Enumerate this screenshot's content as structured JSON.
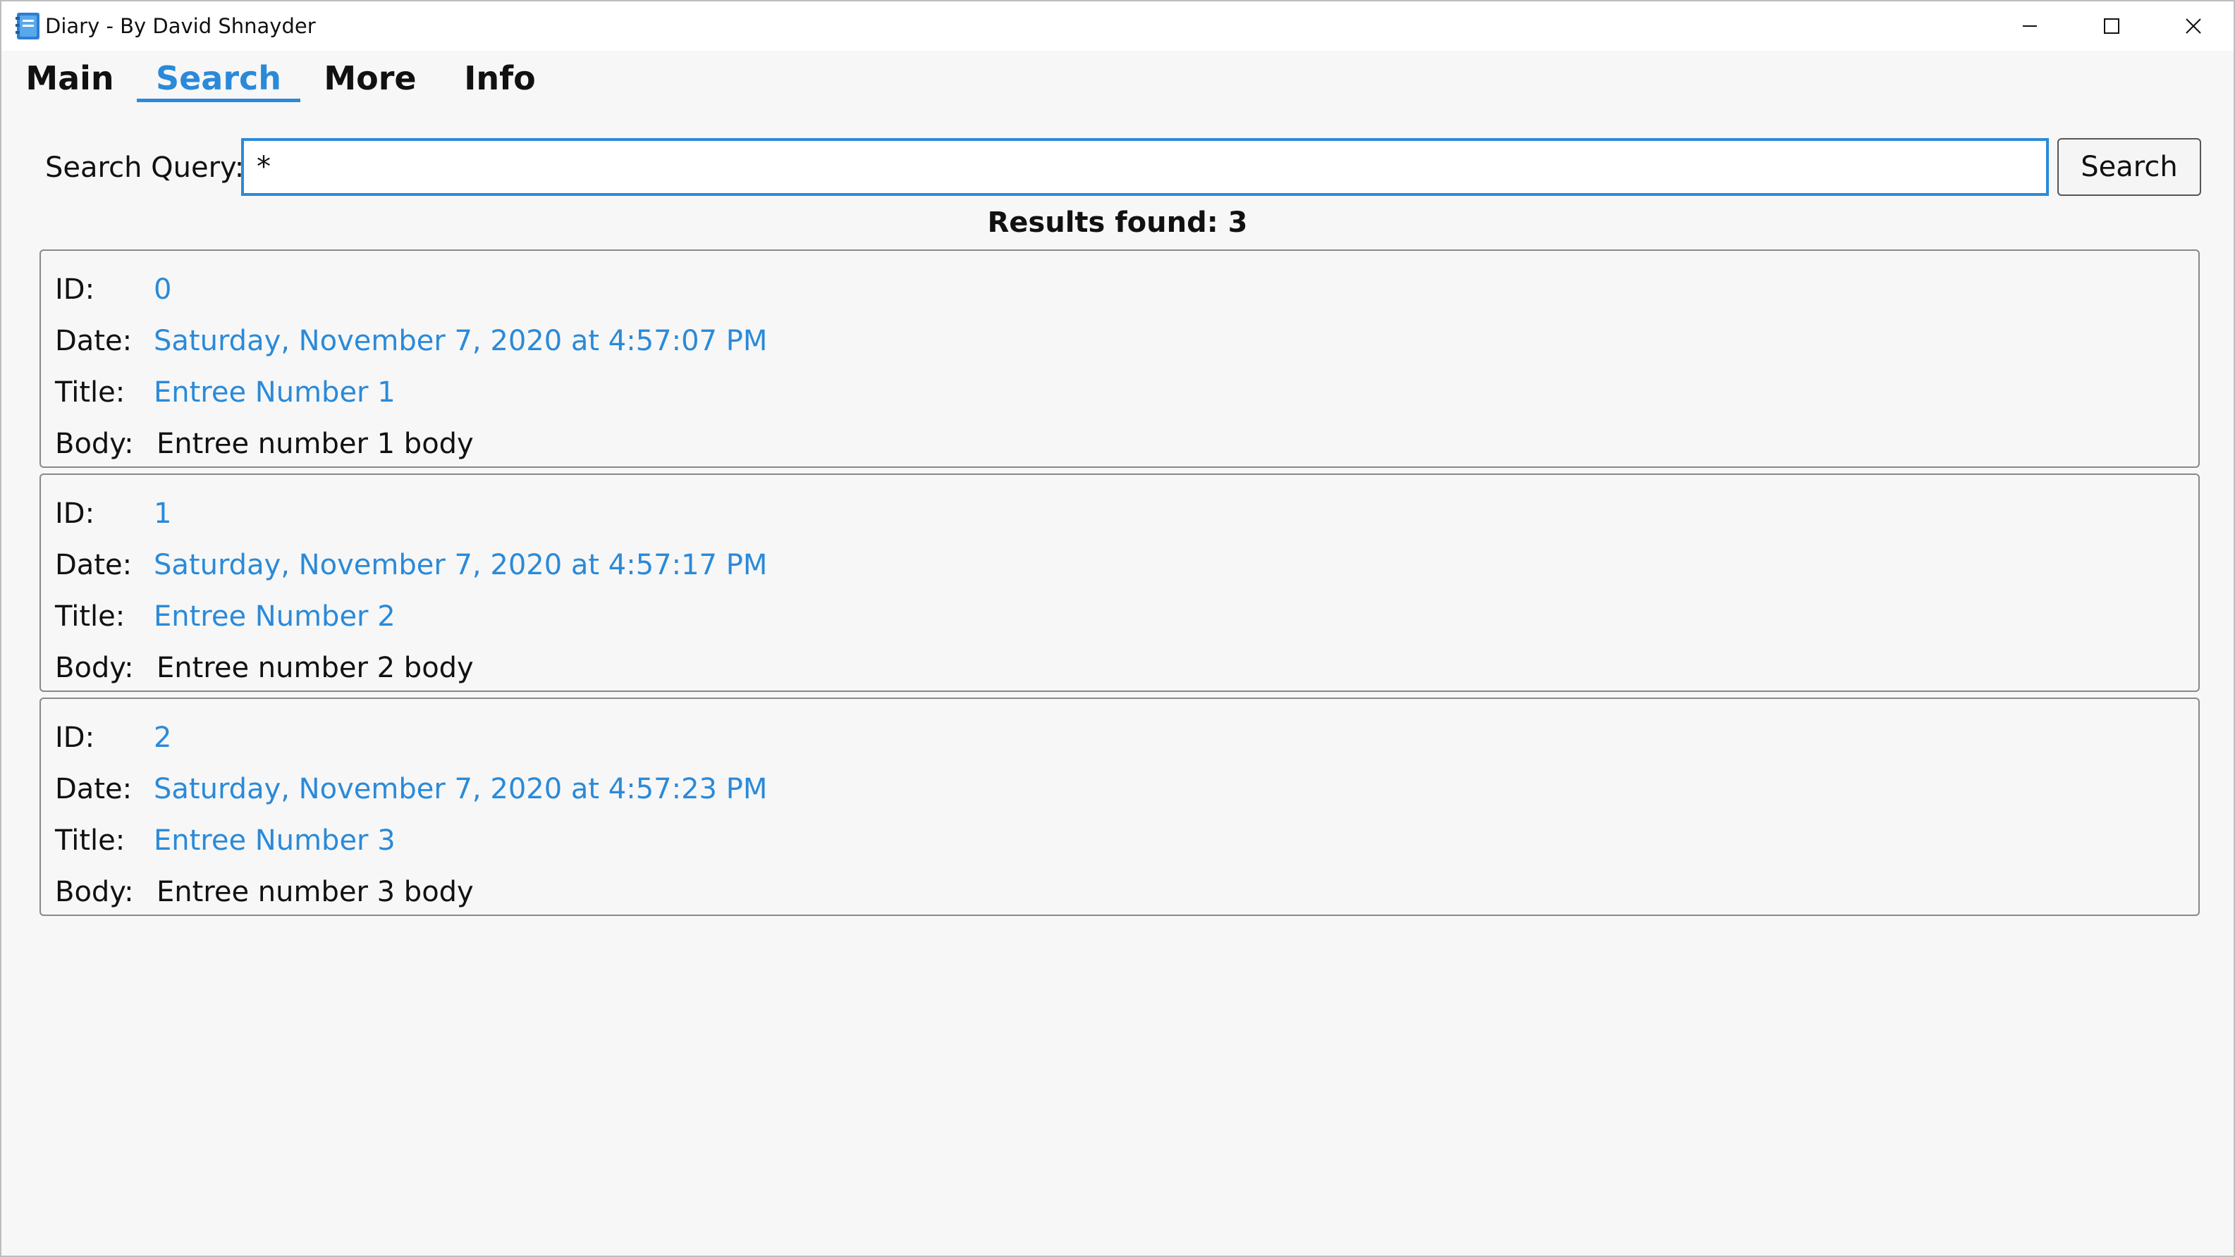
{
  "window": {
    "title": "Diary - By David Shnayder",
    "icon": "diary-book-icon"
  },
  "colors": {
    "accent": "#2a8ad9",
    "text": "#111111",
    "background": "#f7f7f7"
  },
  "tabs": [
    {
      "label": "Main",
      "active": false
    },
    {
      "label": "Search",
      "active": true
    },
    {
      "label": "More",
      "active": false
    },
    {
      "label": "Info",
      "active": false
    }
  ],
  "search": {
    "label": "Search Query:",
    "value": "*",
    "button_label": "Search",
    "results_text": "Results found: 3"
  },
  "field_labels": {
    "id": "ID:",
    "date": "Date:",
    "title": "Title:",
    "body": "Body:"
  },
  "results": [
    {
      "id": "0",
      "date": "Saturday, November 7, 2020 at 4:57:07 PM",
      "title": "Entree Number 1",
      "body": "Entree number 1 body"
    },
    {
      "id": "1",
      "date": "Saturday, November 7, 2020 at 4:57:17 PM",
      "title": "Entree Number 2",
      "body": "Entree number 2 body"
    },
    {
      "id": "2",
      "date": "Saturday, November 7, 2020 at 4:57:23 PM",
      "title": "Entree Number 3",
      "body": "Entree number 3 body"
    }
  ]
}
